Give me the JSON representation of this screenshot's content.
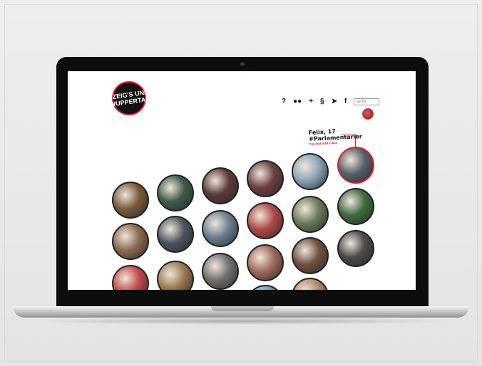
{
  "app": {
    "logo_line1": "#ZEIG'S UNS",
    "logo_line2": "WUPPERTAL",
    "accent_color": "#e21d2b"
  },
  "nav": {
    "help": "?",
    "community_icon": "people-icon",
    "add": "+",
    "legal": "§",
    "twitter_icon": "twitter-icon",
    "facebook": "f",
    "search_placeholder": "Suche"
  },
  "featured": {
    "name": "Felix, 17",
    "tag": "#Parlamentarier",
    "sub": "Tim hat 439 Likes"
  },
  "gallery": {
    "bubble_colors": [
      "#7a5a3a",
      "#3d5a4a",
      "#5c3a35",
      "#6b4040",
      "#8aa5b8",
      "#55606a",
      "#8a6a50",
      "#4a5560",
      "#6a8090",
      "#b04848",
      "#6a7a5a",
      "#3f6a40",
      "#c04a4a",
      "#9a7a50",
      "#707070",
      "#a06a5a",
      "#705040",
      "#4a4a4a",
      "#6a4a40",
      "#a06840",
      "#5a4a40",
      "#7a9ab0",
      "#b08a70"
    ]
  }
}
